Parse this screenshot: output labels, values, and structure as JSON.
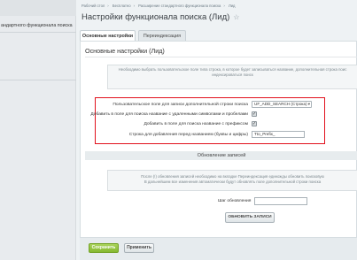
{
  "sidebar": {
    "items": [
      {
        "label": "андартного функционала поиска"
      }
    ]
  },
  "breadcrumbs": [
    "Рабочий стол",
    "Бесплатно",
    "Расширение стандартного функционала поиска",
    "Лид"
  ],
  "page": {
    "title": "Настройки функционала поиска (Лид)",
    "star": "☆"
  },
  "tabs": [
    {
      "label": "Основные настройки"
    },
    {
      "label": "Переиндексация"
    }
  ],
  "panel": {
    "title": "Основные настройки (Лид)",
    "notice_top_lines": [
      "Необходимо выбрать пользовательское поле типа строка, в которое будет записываться название, дополнительная строка поис",
      "индексироваться поиск"
    ],
    "fields": {
      "user_field_label": "Пользовательское поле для записи дополнительной строки поиска",
      "user_field_value": "UF_ADD_SEARCH (Строка)",
      "add_removed_label": "Добавить в поле для поиска название с удаленными символами и пробелами",
      "add_removed_checked": "✓",
      "add_prefix_label": "Добавить в поле для поиска название с префиксом",
      "add_prefix_checked": "✓",
      "prefix_string_label": "Строка для добавления перед названием (буквы и цифры)",
      "prefix_string_value": "Tto_Prefix_"
    },
    "section_title": "Обновление записей",
    "notice_bottom_lines": [
      "После (!) обновления записей необходимо на вкладке Переиндексация единожды обновить поисковую",
      "В дальнейшем все изменения автоматически будут обновлять поле дополнительной строки поиска"
    ],
    "step_label": "Шаг обновления",
    "step_value": "",
    "refresh_button": "ОБНОВИТЬ ЗАПИСИ"
  },
  "footer": {
    "save_label": "Сохранить",
    "apply_label": "Применить"
  },
  "colors": {
    "highlight_border": "#e1101c",
    "save_button": "#86b931",
    "background": "#eef2f4"
  },
  "icons": {
    "star": "star-icon",
    "dropdown": "chevron-down-icon",
    "checkbox": "checkbox-checked-icon"
  }
}
